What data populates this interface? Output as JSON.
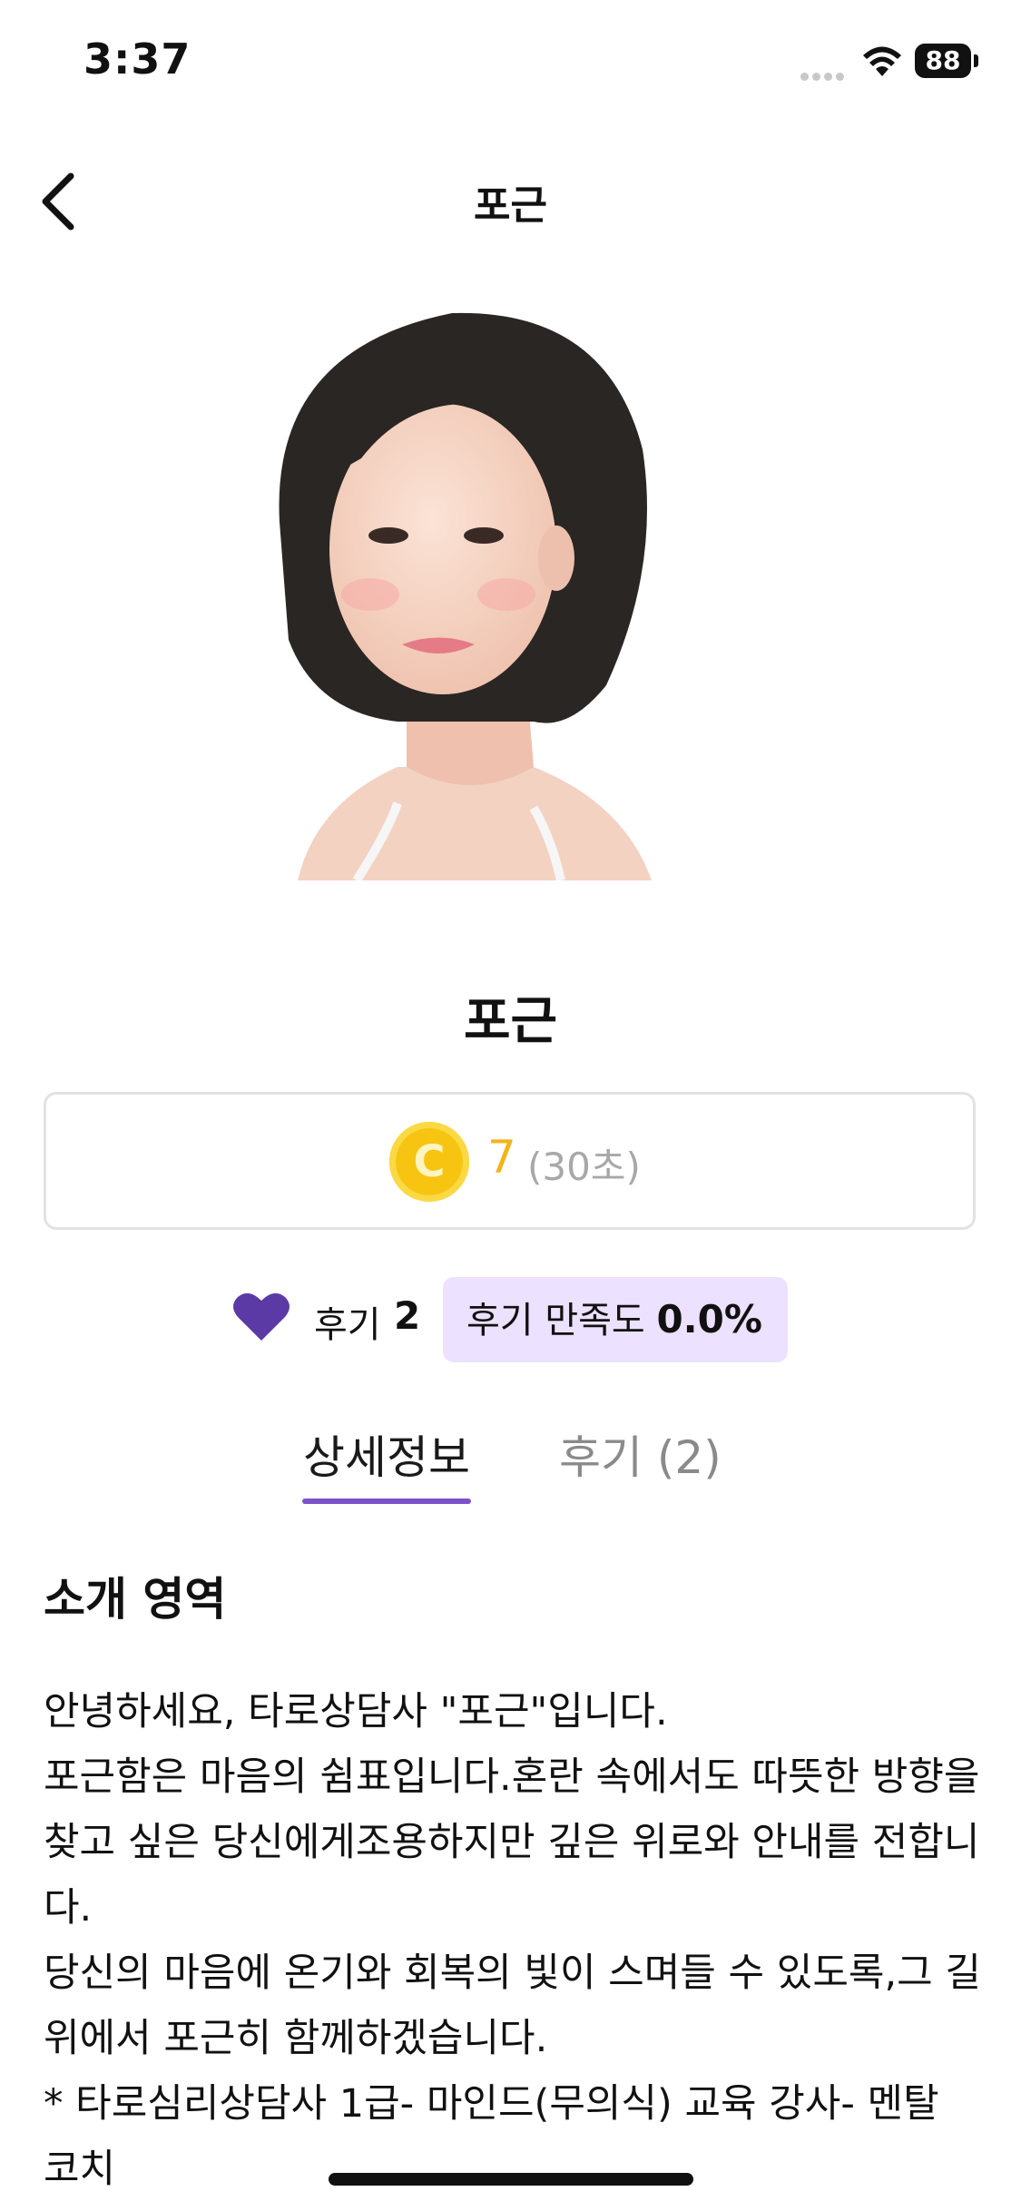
{
  "status_bar": {
    "time": "3:37",
    "battery": "88"
  },
  "nav": {
    "title": "포근"
  },
  "profile": {
    "name": "포근"
  },
  "price": {
    "coin_letter": "C",
    "amount": "7",
    "unit": "(30초)"
  },
  "stats": {
    "review_label": "후기",
    "review_count": "2",
    "satisfaction_label": "후기 만족도",
    "satisfaction_value": "0.0%"
  },
  "tabs": [
    {
      "label": "상세정보",
      "active": true
    },
    {
      "label": "후기 (2)",
      "active": false
    }
  ],
  "intro": {
    "title": "소개 영역",
    "paragraphs": [
      "안녕하세요, 타로상담사 \"포근\"입니다.",
      "포근함은 마음의 쉼표입니다.혼란 속에서도 따뜻한 방향을 찾고 싶은 당신에게조용하지만 깊은 위로와 안내를 전합니다.",
      "당신의 마음에 온기와 회복의 빛이 스며들 수 있도록,그 길 위에서 포근히 함께하겠습니다.",
      "* 타로심리상담사 1급- 마인드(무의식) 교육 강사- 멘탈 코치"
    ]
  },
  "colors": {
    "accent": "#7b52c9",
    "badge_bg": "#ece1ff",
    "coin": "#f7c511",
    "price": "#f3b41a",
    "heart": "#5b3aa6"
  }
}
